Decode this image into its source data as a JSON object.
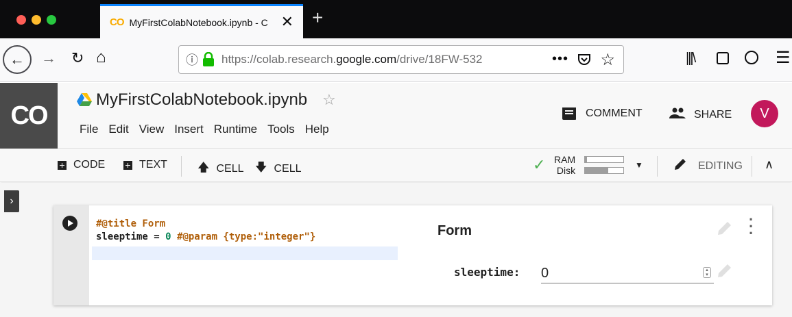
{
  "browser": {
    "tab_title": "MyFirstColabNotebook.ipynb - C",
    "tab_logo": "CO",
    "url_prefix": "https://colab.research.",
    "url_domain": "google.com",
    "url_path": "/drive/18FW-532",
    "more_actions": "•••"
  },
  "colab": {
    "logo": "CO",
    "notebook_title": "MyFirstColabNotebook.ipynb",
    "menu": [
      "File",
      "Edit",
      "View",
      "Insert",
      "Runtime",
      "Tools",
      "Help"
    ],
    "comment_label": "COMMENT",
    "share_label": "SHARE",
    "avatar_initial": "V",
    "avatar_color": "#c2185b"
  },
  "toolbar": {
    "code_label": "CODE",
    "text_label": "TEXT",
    "cell_up_label": "CELL",
    "cell_down_label": "CELL",
    "ram_label": "RAM",
    "disk_label": "Disk",
    "ram_usage": 0.05,
    "disk_usage": 0.6,
    "editing_label": "EDITING",
    "connected_color": "#4caf50"
  },
  "cell": {
    "code_line1": "#@title Form",
    "code_line2_var": "sleeptime = ",
    "code_line2_num": "0",
    "code_line2_comment": " #@param {type:\"integer\"}",
    "form_title": "Form",
    "param_label": "sleeptime:",
    "param_value": "0"
  }
}
